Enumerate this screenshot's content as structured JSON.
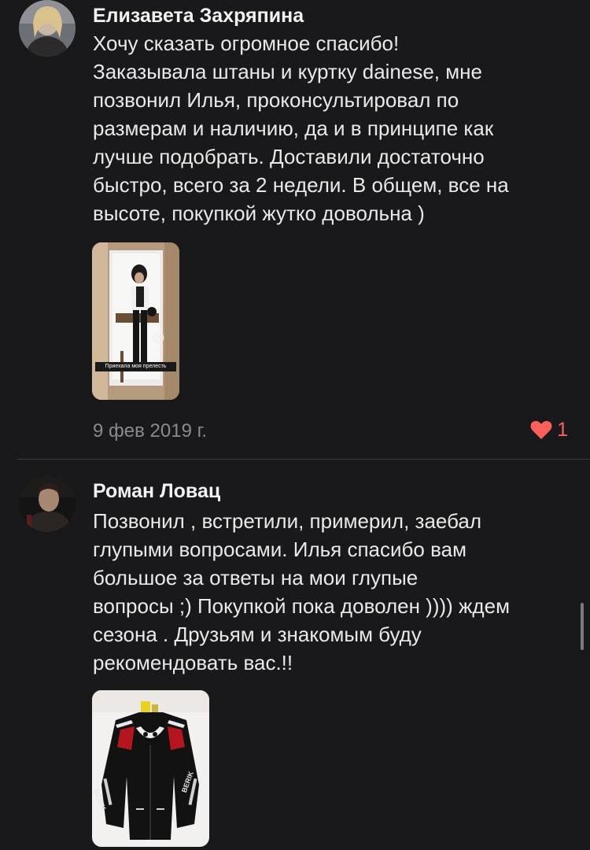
{
  "reviews": [
    {
      "author": "Елизавета Захряпина",
      "lines": [
        "Хочу сказать огромное спасибо!",
        "Заказывала штаны и куртку dainese, мне",
        "позвонил Илья, проконсультировал по",
        "размерам и наличию, да и в принципе как",
        "лучше подобрать. Доставили достаточно",
        "быстро, всего за 2 недели. В общем, все на",
        "высоте, покупкой жутко довольна )"
      ],
      "photo_caption": "Приехала моя прелесть",
      "photo_emoji": "😍",
      "date": "9 фев 2019 г.",
      "likes": "1"
    },
    {
      "author": "Роман Ловац",
      "lines": [
        "Позвонил , встретили, примерил, заебал",
        "глупыми вопросами. Илья спасибо вам",
        "большое  за ответы на мои глупые",
        "вопросы ;) Покупкой пока доволен )))) ждем",
        "сезона . Друзьям и знакомым буду",
        "рекомендовать вас.!!"
      ],
      "photo_brand": "BERIK"
    }
  ],
  "colors": {
    "background": "#19191b",
    "like_red": "#ff5f5a",
    "date_gray": "#8a8a8e"
  }
}
